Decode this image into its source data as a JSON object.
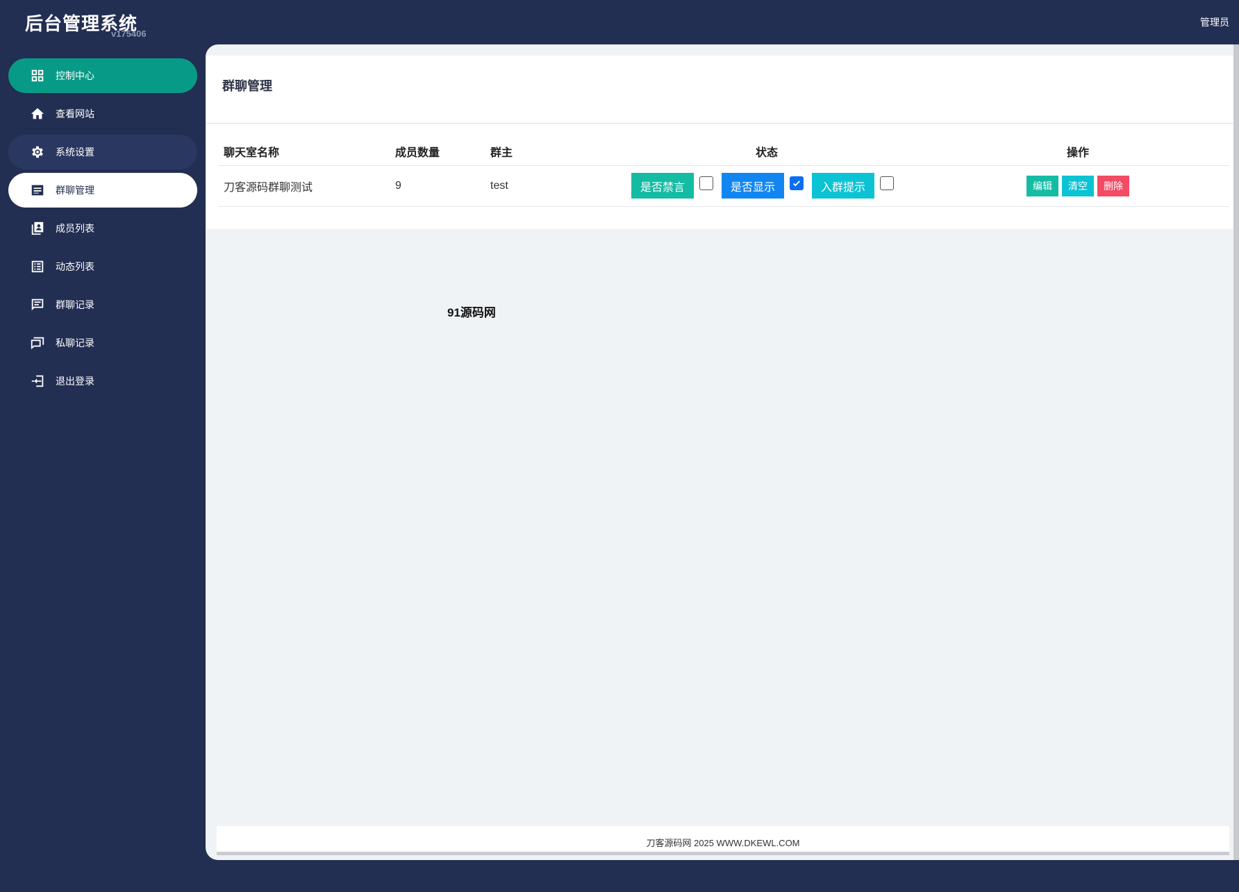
{
  "header": {
    "app_title": "后台管理系统",
    "version": "v175406",
    "user": "管理员"
  },
  "sidebar": {
    "items": [
      {
        "label": "控制中心",
        "icon": "dashboard-icon"
      },
      {
        "label": "查看网站",
        "icon": "home-icon"
      },
      {
        "label": "系统设置",
        "icon": "gear-icon"
      },
      {
        "label": "群聊管理",
        "icon": "list-icon"
      },
      {
        "label": "成员列表",
        "icon": "contacts-icon"
      },
      {
        "label": "动态列表",
        "icon": "article-icon"
      },
      {
        "label": "群聊记录",
        "icon": "chat-icon"
      },
      {
        "label": "私聊记录",
        "icon": "forum-icon"
      },
      {
        "label": "退出登录",
        "icon": "logout-icon"
      }
    ]
  },
  "main": {
    "title": "群聊管理",
    "table": {
      "columns": [
        "聊天室名称",
        "成员数量",
        "群主",
        "状态",
        "操作"
      ],
      "rows": [
        {
          "name": "刀客源码群聊测试",
          "members": "9",
          "owner": "test",
          "status": {
            "mute_label": "是否禁言",
            "mute_checked": false,
            "show_label": "是否显示",
            "show_checked": true,
            "notice_label": "入群提示",
            "notice_checked": false
          },
          "actions": {
            "edit": "编辑",
            "clear": "清空",
            "delete": "删除"
          }
        }
      ]
    },
    "watermark": "91源码网",
    "footer": "刀客源码网 2025 WWW.DKEWL.COM"
  },
  "colors": {
    "background": "#222e52",
    "accent": "#079b87",
    "teal": "#15bca4",
    "blue": "#1286f0",
    "cyan": "#0cc3d4",
    "danger": "#f24b63"
  }
}
